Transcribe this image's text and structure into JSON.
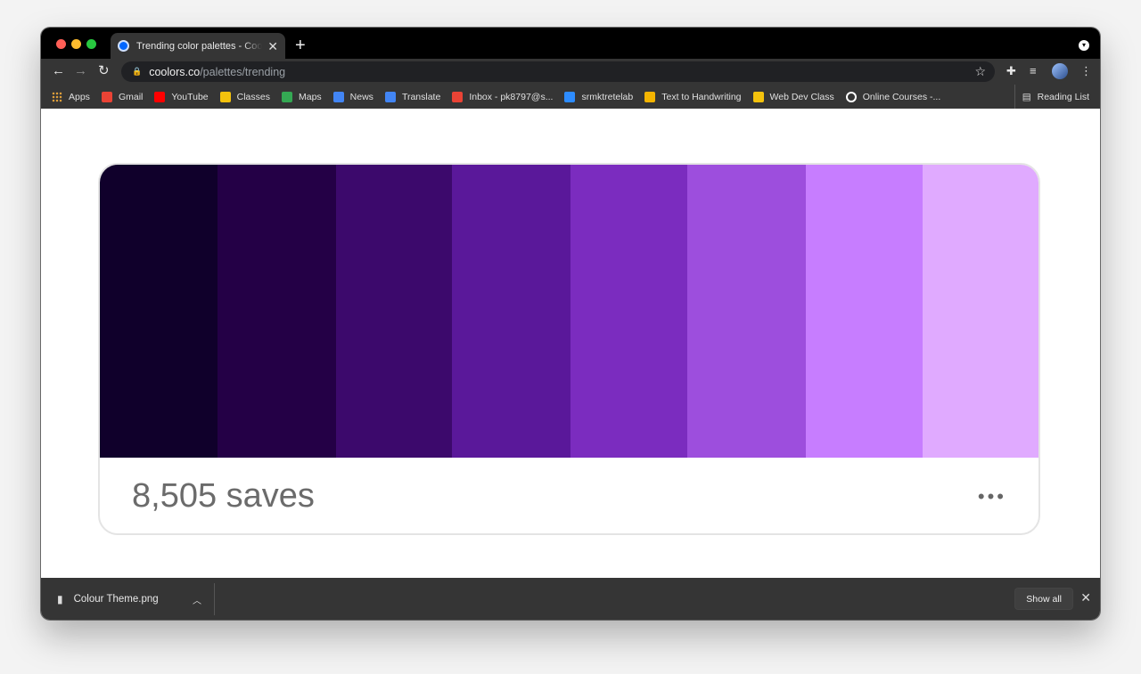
{
  "browser": {
    "tab": {
      "title": "Trending color palettes - Coolors"
    },
    "url": {
      "host": "coolors.co",
      "path": "/palettes/trending"
    }
  },
  "bookmarks": [
    {
      "label": "Apps",
      "icon": "apps-grid-icon",
      "color": "#e2a13a"
    },
    {
      "label": "Gmail",
      "icon": "gmail-icon",
      "color": "#ea4335"
    },
    {
      "label": "YouTube",
      "icon": "youtube-icon",
      "color": "#ff0000"
    },
    {
      "label": "Classes",
      "icon": "classroom-icon",
      "color": "#f4c20d"
    },
    {
      "label": "Maps",
      "icon": "maps-icon",
      "color": "#34a853"
    },
    {
      "label": "News",
      "icon": "news-icon",
      "color": "#4285f4"
    },
    {
      "label": "Translate",
      "icon": "translate-icon",
      "color": "#4285f4"
    },
    {
      "label": "Inbox - pk8797@s...",
      "icon": "gmail-icon",
      "color": "#ea4335"
    },
    {
      "label": "srmktretelab",
      "icon": "cloud-icon",
      "color": "#2d8cff"
    },
    {
      "label": "Text to Handwriting",
      "icon": "hand-writing-icon",
      "color": "#f4b400"
    },
    {
      "label": "Web Dev Class",
      "icon": "classroom-icon",
      "color": "#f4c20d"
    },
    {
      "label": "Online Courses -...",
      "icon": "lock-badge-icon",
      "color": "#ffffff"
    }
  ],
  "reading_list": {
    "label": "Reading List"
  },
  "palette": {
    "colors": [
      "#10002b",
      "#240046",
      "#3c096c",
      "#5a189a",
      "#7b2cbf",
      "#9d4edd",
      "#c77dff",
      "#e0aaff"
    ],
    "saves_label": "8,505 saves",
    "more_label": "•••"
  },
  "downloads": {
    "file_name": "Colour Theme.png",
    "show_all_label": "Show all"
  }
}
